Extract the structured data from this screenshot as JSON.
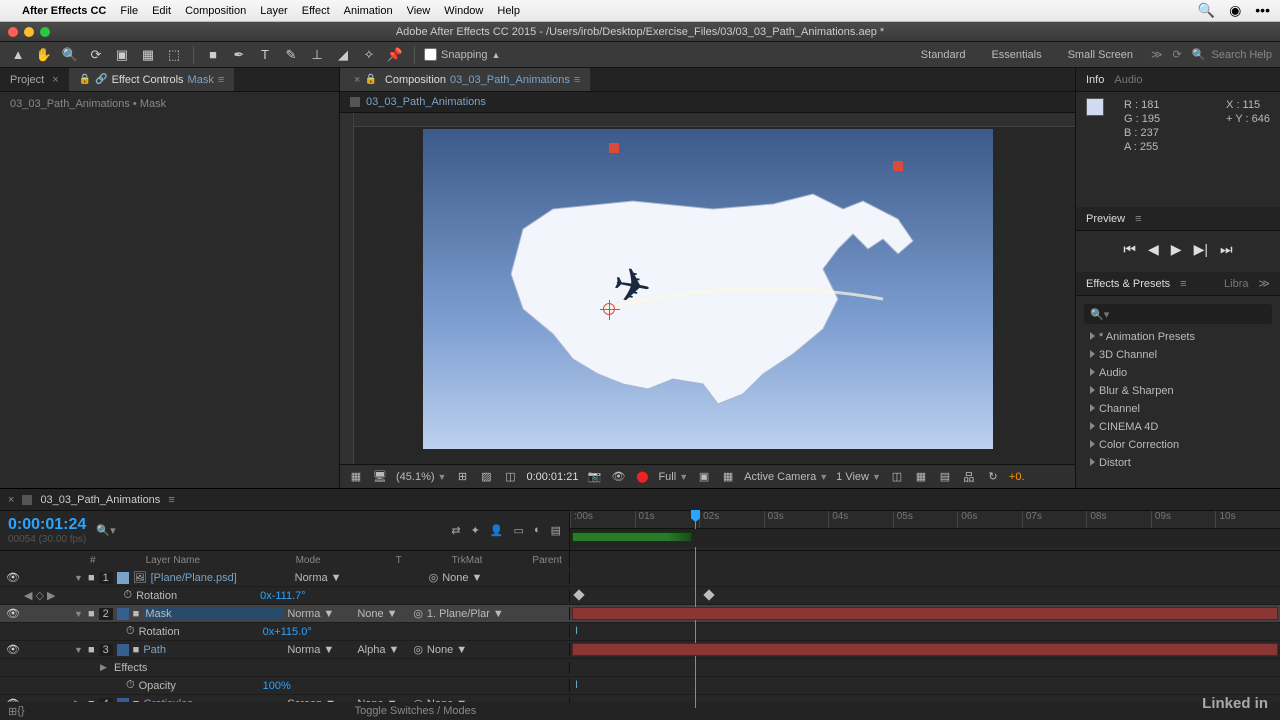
{
  "menubar": {
    "app": "After Effects CC",
    "items": [
      "File",
      "Edit",
      "Composition",
      "Layer",
      "Effect",
      "Animation",
      "View",
      "Window",
      "Help"
    ]
  },
  "titlebar": "Adobe After Effects CC 2015 - /Users/irob/Desktop/Exercise_Files/03/03_03_Path_Animations.aep *",
  "toolbar": {
    "snapping": "Snapping",
    "workspaces": [
      "Standard",
      "Essentials",
      "Small Screen"
    ],
    "search_placeholder": "Search Help"
  },
  "left_panel": {
    "tabs": {
      "project": "Project",
      "effect_controls": "Effect Controls",
      "ec_target": "Mask"
    },
    "crumb": "03_03_Path_Animations • Mask"
  },
  "center_panel": {
    "tabs": {
      "composition": "Composition",
      "comp_name": "03_03_Path_Animations"
    },
    "crumb": "03_03_Path_Animations",
    "footer": {
      "mag": "(45.1%)",
      "time": "0:00:01:21",
      "res": "Full",
      "camera": "Active Camera",
      "views": "1 View",
      "exposure": "+0."
    }
  },
  "info_panel": {
    "tabs": [
      "Info",
      "Audio"
    ],
    "r": "R : 181",
    "g": "G : 195",
    "b": "B : 237",
    "a": "A : 255",
    "x": "X : 115",
    "y": "Y : 646"
  },
  "preview_panel": {
    "title": "Preview"
  },
  "effects_presets": {
    "title": "Effects & Presets",
    "libra": "Libra",
    "items": [
      "* Animation Presets",
      "3D Channel",
      "Audio",
      "Blur & Sharpen",
      "Channel",
      "CINEMA 4D",
      "Color Correction",
      "Distort"
    ]
  },
  "timeline": {
    "tab": "03_03_Path_Animations",
    "timecode": "0:00:01:24",
    "fps": "00054 (30.00 fps)",
    "columns": {
      "num": "#",
      "name": "Layer Name",
      "mode": "Mode",
      "t": "T",
      "trk": "TrkMat",
      "parent": "Parent"
    },
    "ticks": [
      ":00s",
      "01s",
      "02s",
      "03s",
      "04s",
      "05s",
      "06s",
      "07s",
      "08s",
      "09s",
      "10s"
    ],
    "layers": [
      {
        "n": "1",
        "name": "[Plane/Plane.psd]",
        "color": "#7aa3c9",
        "mode": "Norma",
        "parent": "None"
      },
      {
        "prop": "Rotation",
        "val": "0x-111.7°"
      },
      {
        "n": "2",
        "name": "Mask",
        "color": "#365f8f",
        "mode": "Norma",
        "trk": "None",
        "parent": "1. Plane/Plar",
        "sel": true
      },
      {
        "prop": "Rotation",
        "val": "0x+115.0°"
      },
      {
        "n": "3",
        "name": "Path",
        "color": "#365f8f",
        "mode": "Norma",
        "trk": "Alpha",
        "parent": "None"
      },
      {
        "prop": "Effects"
      },
      {
        "prop": "Opacity",
        "val": "100%"
      },
      {
        "n": "4",
        "name": "Graticules",
        "color": "#365f8f",
        "mode": "Screen",
        "trk": "None",
        "parent": "None"
      }
    ],
    "footer": "Toggle Switches / Modes"
  },
  "watermark": "Linked in"
}
